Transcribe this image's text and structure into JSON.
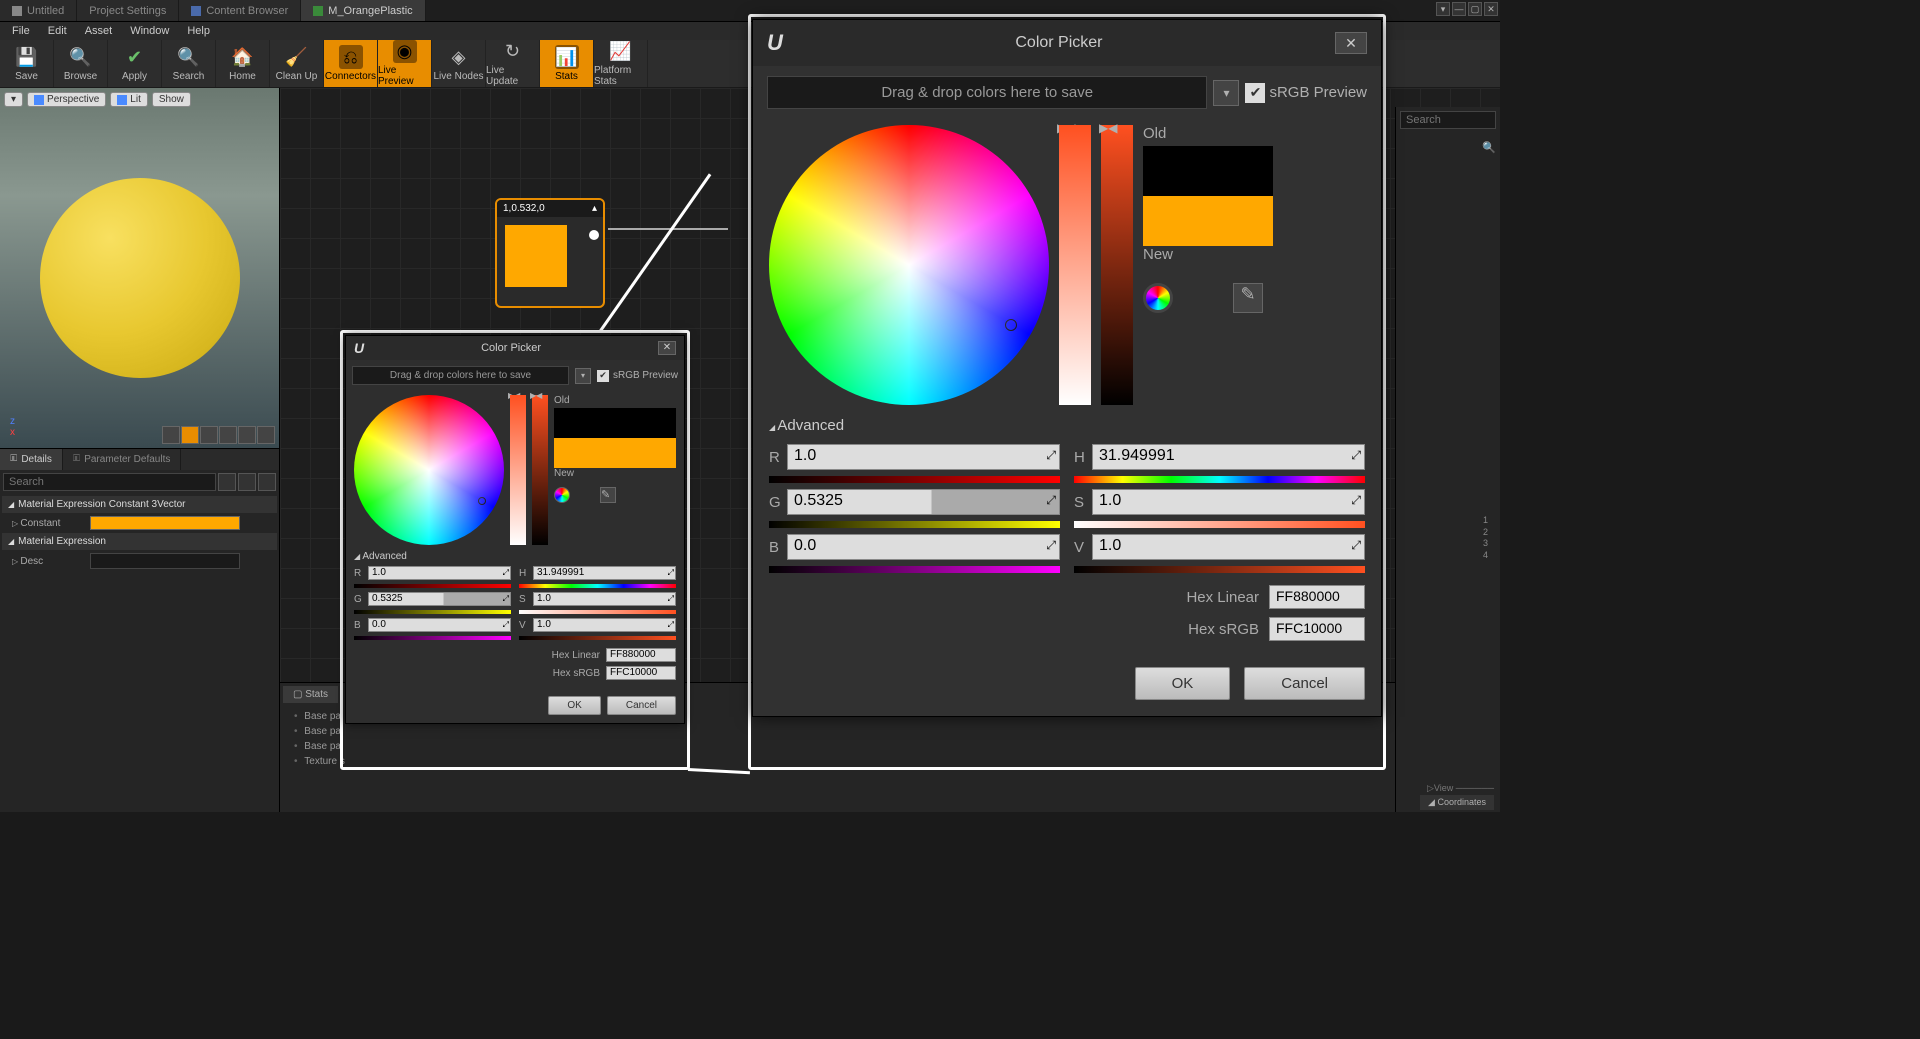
{
  "tabs": {
    "untitled": "Untitled",
    "project_settings": "Project Settings",
    "content_browser": "Content Browser",
    "material": "M_OrangePlastic"
  },
  "menu": {
    "file": "File",
    "edit": "Edit",
    "asset": "Asset",
    "window": "Window",
    "help": "Help"
  },
  "toolbar": {
    "save": "Save",
    "browse": "Browse",
    "apply": "Apply",
    "search": "Search",
    "home": "Home",
    "cleanup": "Clean Up",
    "connectors": "Connectors",
    "live_preview": "Live Preview",
    "live_nodes": "Live Nodes",
    "live_update": "Live Update",
    "stats": "Stats",
    "platform_stats": "Platform Stats"
  },
  "viewport": {
    "perspective": "Perspective",
    "lit": "Lit",
    "show": "Show"
  },
  "details_tabs": {
    "details": "Details",
    "params": "Parameter Defaults"
  },
  "search_placeholder": "Search",
  "details": {
    "sec1": "Material Expression Constant 3Vector",
    "constant_label": "Constant",
    "sec2": "Material Expression",
    "desc_label": "Desc"
  },
  "node": {
    "title": "1,0.532,0"
  },
  "stats": {
    "title": "Stats",
    "items": [
      "Base pa",
      "Base pa",
      "Base pa",
      "Texture s"
    ]
  },
  "right": {
    "nums": [
      "1",
      "2",
      "3",
      "4"
    ],
    "view": "▷View ──────",
    "coords": "Coordinates"
  },
  "picker": {
    "title": "Color Picker",
    "drag_hint": "Drag & drop colors here to save",
    "srgb": "sRGB Preview",
    "old": "Old",
    "new": "New",
    "advanced": "Advanced",
    "r": "1.0",
    "g": "0.5325",
    "b": "0.0",
    "h": "31.949991",
    "s": "1.0",
    "v": "1.0",
    "hex_linear_label": "Hex Linear",
    "hex_linear": "FF880000",
    "hex_srgb_label": "Hex sRGB",
    "hex_srgb": "FFC10000",
    "ok": "OK",
    "cancel": "Cancel",
    "labels": {
      "R": "R",
      "G": "G",
      "B": "B",
      "H": "H",
      "S": "S",
      "V": "V"
    }
  }
}
